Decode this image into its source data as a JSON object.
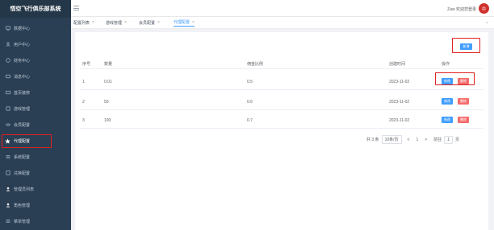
{
  "app": {
    "title": "悟空飞行俱乐部系统"
  },
  "sidebar": {
    "items": [
      {
        "label": "数据中心",
        "icon": "monitor-icon"
      },
      {
        "label": "用户中心",
        "icon": "user-icon"
      },
      {
        "label": "财务中心",
        "icon": "finance-icon"
      },
      {
        "label": "消息中心",
        "icon": "message-icon"
      },
      {
        "label": "首页装修",
        "icon": "home-decor-icon"
      },
      {
        "label": "游戏管理",
        "icon": "game-icon"
      },
      {
        "label": "会员配置",
        "icon": "member-icon"
      },
      {
        "label": "代理配置",
        "icon": "star-icon"
      },
      {
        "label": "系统配置",
        "icon": "system-icon"
      },
      {
        "label": "兑换配置",
        "icon": "exchange-icon"
      },
      {
        "label": "管理员列表",
        "icon": "admin-icon"
      },
      {
        "label": "角色管理",
        "icon": "role-icon"
      },
      {
        "label": "菜单管理",
        "icon": "menu-icon"
      }
    ]
  },
  "header": {
    "user_text": "Zaw 欢迎您登录"
  },
  "tabs": [
    {
      "label": "配置列表"
    },
    {
      "label": "游戏管理"
    },
    {
      "label": "会员配置"
    },
    {
      "label": "代理配置"
    }
  ],
  "toolbar": {
    "add_label": "新增"
  },
  "table": {
    "columns": [
      "序号",
      "数量",
      "佣金比例",
      "创建时间",
      "操作"
    ],
    "rows": [
      {
        "index": "1",
        "amount": "0.01",
        "ratio": "0.5",
        "created": "2023-11-02"
      },
      {
        "index": "2",
        "amount": "50",
        "ratio": "0.6",
        "created": "2023-11-02"
      },
      {
        "index": "3",
        "amount": "100",
        "ratio": "0.7",
        "created": "2023-11-02"
      }
    ],
    "edit_label": "修改",
    "delete_label": "删除"
  },
  "pagination": {
    "total": "共 3 条",
    "page_size": "10条/页",
    "prev": "<",
    "page": "1",
    "next": ">",
    "goto_label": "前往",
    "goto_value": "1",
    "page_suffix": "页"
  },
  "colors": {
    "sidebar_bg": "#2a3f54",
    "primary": "#409eff",
    "danger": "#f56c6c",
    "highlight": "#e02020"
  }
}
